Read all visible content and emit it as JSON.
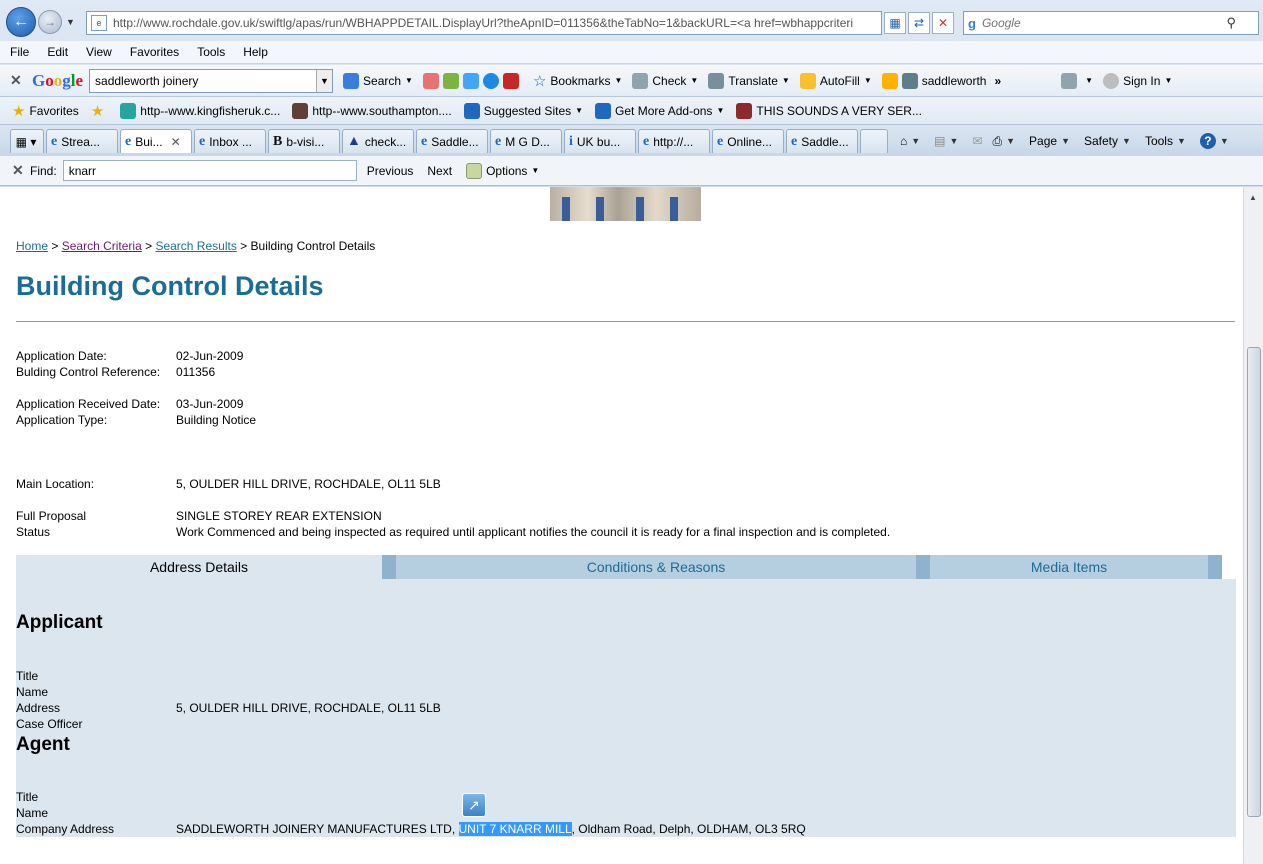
{
  "browser": {
    "url": "http://www.rochdale.gov.uk/swiftlg/apas/run/WBHAPPDETAIL.DisplayUrl?theApnID=011356&theTabNo=1&backURL=<a href=wbhappcriteri",
    "search_placeholder": "Google",
    "menu": [
      "File",
      "Edit",
      "View",
      "Favorites",
      "Tools",
      "Help"
    ],
    "google_toolbar": {
      "query": "saddleworth joinery",
      "search": "Search",
      "bookmarks": "Bookmarks",
      "check": "Check",
      "translate": "Translate",
      "autofill": "AutoFill",
      "highlight_term": "saddleworth"
    },
    "tools_right": {
      "sign_in": "Sign In"
    },
    "favorites": {
      "label": "Favorites",
      "items": [
        "http--www.kingfisheruk.c...",
        "http--www.southampton....",
        "Suggested Sites",
        "Get More Add-ons",
        "THIS SOUNDS A VERY SER..."
      ]
    },
    "tabs": [
      "Strea...",
      "Bui...",
      "Inbox ...",
      "b-visi...",
      "check...",
      "Saddle...",
      "M G D...",
      "UK bu...",
      "http://...",
      "Online...",
      "Saddle..."
    ],
    "command_bar": {
      "page": "Page",
      "safety": "Safety",
      "tools": "Tools"
    },
    "find": {
      "label": "Find:",
      "value": "knarr",
      "previous": "Previous",
      "next": "Next",
      "options": "Options"
    }
  },
  "page": {
    "breadcrumb": {
      "home": "Home",
      "search_criteria": "Search Criteria",
      "search_results": "Search Results",
      "current": "Building Control Details",
      "sep": ">"
    },
    "title": "Building Control Details",
    "details": {
      "application_date_label": "Application Date:",
      "application_date": "02-Jun-2009",
      "reference_label": "Bulding Control Reference:",
      "reference": "011356",
      "received_label": "Application Received Date:",
      "received": "03-Jun-2009",
      "type_label": "Application Type:",
      "type": "Building Notice",
      "location_label": "Main Location:",
      "location": "5, OULDER HILL DRIVE, ROCHDALE, OL11 5LB",
      "proposal_label": "Full Proposal",
      "proposal": "SINGLE STOREY REAR EXTENSION",
      "status_label": "Status",
      "status": "Work Commenced and being inspected as required until applicant notifies the council it is ready for a final inspection and is completed."
    },
    "tabs": {
      "address": "Address Details",
      "conditions": "Conditions & Reasons",
      "media": "Media Items"
    },
    "applicant": {
      "heading": "Applicant",
      "title_label": "Title",
      "name_label": "Name",
      "address_label": "Address",
      "address": "5, OULDER HILL DRIVE, ROCHDALE, OL11 5LB",
      "case_officer_label": "Case Officer"
    },
    "agent": {
      "heading": "Agent",
      "title_label": "Title",
      "name_label": "Name",
      "company_address_label": "Company Address",
      "address_part1": "SADDLEWORTH JOINERY MANUFACTURES LTD, ",
      "address_highlight": "UNIT 7 KNARR MILL",
      "address_part2": ", Oldham Road, Delph, OLDHAM, OL3 5RQ"
    }
  },
  "colors": {
    "title_blue": "#1b6d94",
    "pane_bg": "#dbe6ef",
    "highlight": "#3399ff"
  }
}
